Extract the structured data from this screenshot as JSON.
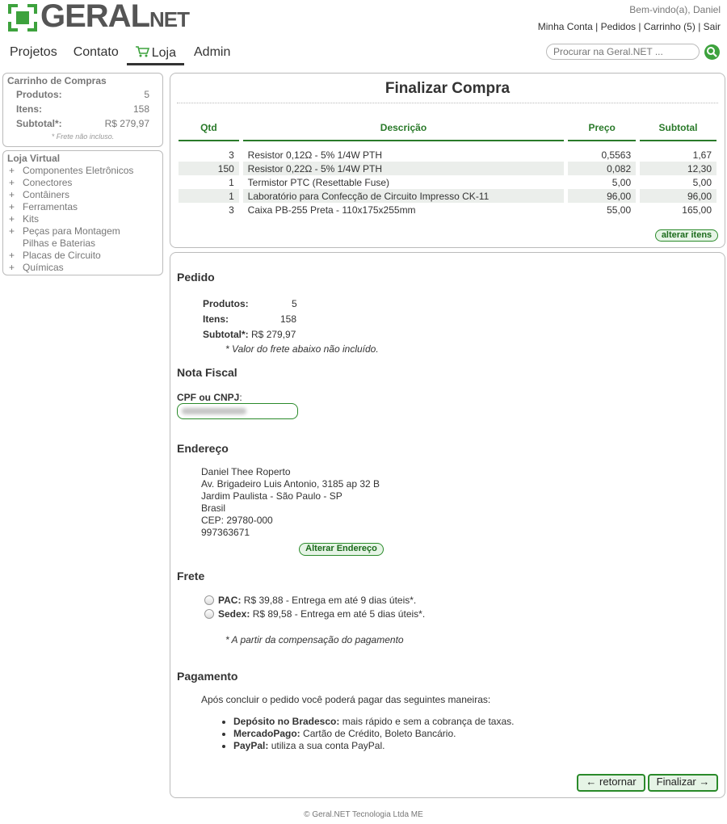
{
  "brand": {
    "name": "GERAL",
    "suffix": "NET",
    "accent": "#3da23d"
  },
  "header": {
    "welcome": "Bem-vindo(a), Daniel",
    "links": {
      "account": "Minha Conta",
      "orders": "Pedidos",
      "cart": "Carrinho (5)",
      "logout": "Sair",
      "sep": "|"
    }
  },
  "nav": {
    "projects": "Projetos",
    "contact": "Contato",
    "shop": "Loja",
    "admin": "Admin"
  },
  "search": {
    "placeholder": "Procurar na Geral.NET ..."
  },
  "sidebar": {
    "cart": {
      "title": "Carrinho de Compras",
      "rows": [
        {
          "label": "Produtos:",
          "value": "5"
        },
        {
          "label": "Itens:",
          "value": "158"
        },
        {
          "label": "Subtotal*:",
          "value": "R$ 279,97"
        }
      ],
      "note": "* Frete não incluso."
    },
    "shop": {
      "title": "Loja Virtual",
      "categories": [
        {
          "plus": "+",
          "label": "Componentes Eletrônicos"
        },
        {
          "plus": "+",
          "label": "Conectores"
        },
        {
          "plus": "+",
          "label": "Contâiners"
        },
        {
          "plus": "+",
          "label": "Ferramentas"
        },
        {
          "plus": "+",
          "label": "Kits"
        },
        {
          "plus": "+",
          "label": "Peças para Montagem"
        },
        {
          "plus": "",
          "label": "Pilhas e Baterias"
        },
        {
          "plus": "+",
          "label": "Placas de Circuito"
        },
        {
          "plus": "+",
          "label": "Químicas"
        }
      ]
    }
  },
  "checkout": {
    "title": "Finalizar Compra",
    "table": {
      "headers": {
        "qty": "Qtd",
        "desc": "Descrição",
        "price": "Preço",
        "subtotal": "Subtotal"
      },
      "rows": [
        {
          "qty": "3",
          "desc": "Resistor 0,12Ω - 5% 1/4W PTH",
          "price": "0,5563",
          "subtotal": "1,67"
        },
        {
          "qty": "150",
          "desc": "Resistor 0,22Ω - 5% 1/4W PTH",
          "price": "0,082",
          "subtotal": "12,30"
        },
        {
          "qty": "1",
          "desc": "Termistor PTC (Resettable Fuse)",
          "price": "5,00",
          "subtotal": "5,00"
        },
        {
          "qty": "1",
          "desc": "Laboratório para Confecção de Circuito Impresso CK-11",
          "price": "96,00",
          "subtotal": "96,00"
        },
        {
          "qty": "3",
          "desc": "Caixa PB-255 Preta - 110x175x255mm",
          "price": "55,00",
          "subtotal": "165,00"
        }
      ]
    },
    "alter_items": "alterar itens"
  },
  "order": {
    "heading": "Pedido",
    "products_label": "Produtos:",
    "products_value": "5",
    "items_label": "Itens:",
    "items_value": "158",
    "subtotal_label": "Subtotal*:",
    "subtotal_value": "R$ 279,97",
    "note": "* Valor do frete abaixo não incluído."
  },
  "invoice": {
    "heading": "Nota Fiscal",
    "cpf_label": "CPF ou CNPJ",
    "cpf_colon": ":"
  },
  "address": {
    "heading": "Endereço",
    "lines": [
      "Daniel Thee Roperto",
      "Av. Brigadeiro Luis Antonio, 3185 ap 32 B",
      "Jardim Paulista - São Paulo - SP",
      "Brasil",
      "CEP: 29780-000",
      "997363671"
    ],
    "change_button": "Alterar Endereço"
  },
  "shipping": {
    "heading": "Frete",
    "options": [
      {
        "name": "PAC:",
        "text": "R$ 39,88 - Entrega em até 9 dias úteis*."
      },
      {
        "name": "Sedex:",
        "text": "R$ 89,58 - Entrega em até 5 dias úteis*."
      }
    ],
    "note": "* A partir da compensação do pagamento"
  },
  "payment": {
    "heading": "Pagamento",
    "intro": "Após concluir o pedido você poderá pagar das seguintes maneiras:",
    "methods": [
      {
        "name": "Depósito no Bradesco:",
        "text": "mais rápido e sem a cobrança de taxas."
      },
      {
        "name": "MercadoPago:",
        "text": "Cartão de Crédito, Boleto Bancário."
      },
      {
        "name": "PayPal:",
        "text": "utiliza a sua conta PayPal."
      }
    ]
  },
  "actions": {
    "back": "← retornar",
    "finish": "Finalizar →"
  },
  "footer": "© Geral.NET Tecnologia Ltda ME"
}
